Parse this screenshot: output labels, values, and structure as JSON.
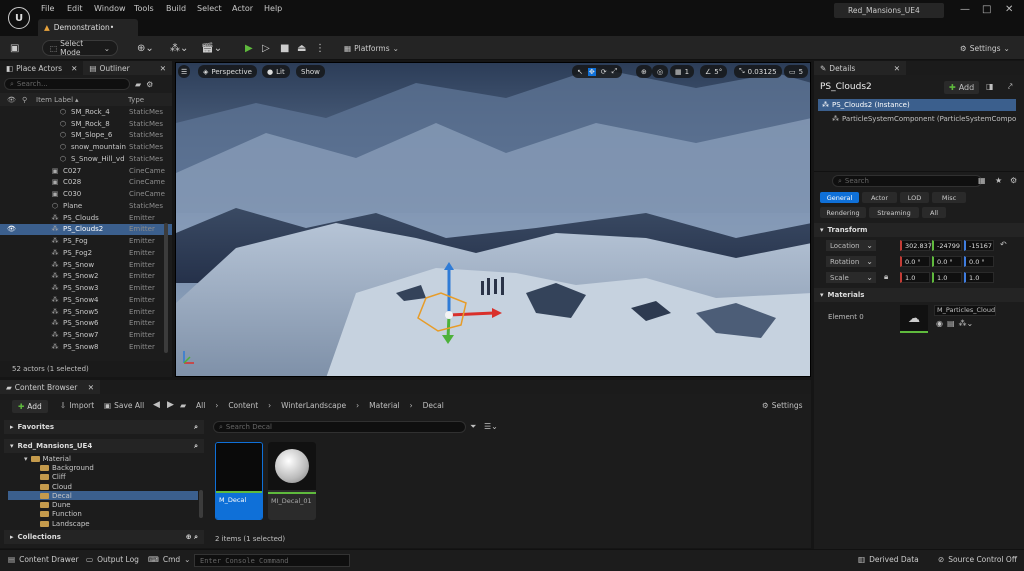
{
  "titlebar": {
    "menu": [
      "File",
      "Edit",
      "Window",
      "Tools",
      "Build",
      "Select",
      "Actor",
      "Help"
    ],
    "document_tab": "Demonstration•",
    "project_name": "Red_Mansions_UE4"
  },
  "toolbar": {
    "select_mode": "Select Mode",
    "platforms": "Platforms",
    "settings": "Settings"
  },
  "outliner": {
    "tabs": [
      "Place Actors",
      "Outliner"
    ],
    "search_placeholder": "Search...",
    "col_label": "Item Label",
    "col_type": "Type",
    "rows": [
      {
        "label": "SM_Rock_4",
        "type": "StaticMes",
        "icon": "mesh",
        "indent": 2
      },
      {
        "label": "SM_Rock_8",
        "type": "StaticMes",
        "icon": "mesh",
        "indent": 2
      },
      {
        "label": "SM_Slope_6",
        "type": "StaticMes",
        "icon": "mesh",
        "indent": 2
      },
      {
        "label": "snow_mountain",
        "type": "StaticMes",
        "icon": "mesh",
        "indent": 2
      },
      {
        "label": "S_Snow_Hill_vd",
        "type": "StaticMes",
        "icon": "mesh",
        "indent": 2
      },
      {
        "label": "C027",
        "type": "CineCame",
        "icon": "camera",
        "indent": 1
      },
      {
        "label": "C028",
        "type": "CineCame",
        "icon": "camera",
        "indent": 1
      },
      {
        "label": "C030",
        "type": "CineCame",
        "icon": "camera",
        "indent": 1
      },
      {
        "label": "Plane",
        "type": "StaticMes",
        "icon": "mesh",
        "indent": 1
      },
      {
        "label": "PS_Clouds",
        "type": "Emitter",
        "icon": "emitter",
        "indent": 1
      },
      {
        "label": "PS_Clouds2",
        "type": "Emitter",
        "icon": "emitter",
        "indent": 1,
        "selected": true
      },
      {
        "label": "PS_Fog",
        "type": "Emitter",
        "icon": "emitter",
        "indent": 1
      },
      {
        "label": "PS_Fog2",
        "type": "Emitter",
        "icon": "emitter",
        "indent": 1
      },
      {
        "label": "PS_Snow",
        "type": "Emitter",
        "icon": "emitter",
        "indent": 1
      },
      {
        "label": "PS_Snow2",
        "type": "Emitter",
        "icon": "emitter",
        "indent": 1
      },
      {
        "label": "PS_Snow3",
        "type": "Emitter",
        "icon": "emitter",
        "indent": 1
      },
      {
        "label": "PS_Snow4",
        "type": "Emitter",
        "icon": "emitter",
        "indent": 1
      },
      {
        "label": "PS_Snow5",
        "type": "Emitter",
        "icon": "emitter",
        "indent": 1
      },
      {
        "label": "PS_Snow6",
        "type": "Emitter",
        "icon": "emitter",
        "indent": 1
      },
      {
        "label": "PS_Snow7",
        "type": "Emitter",
        "icon": "emitter",
        "indent": 1
      },
      {
        "label": "PS_Snow8",
        "type": "Emitter",
        "icon": "emitter",
        "indent": 1
      }
    ],
    "footer": "52 actors (1 selected)"
  },
  "viewport": {
    "perspective": "Perspective",
    "lit": "Lit",
    "show": "Show",
    "grid": "1",
    "angle": "5°",
    "scale": "0.03125",
    "camera_speed": "5"
  },
  "details": {
    "tab": "Details",
    "actor_name": "PS_Clouds2",
    "add": "Add",
    "instance": "PS_Clouds2 (Instance)",
    "component": "ParticleSystemComponent (ParticleSystemCompo",
    "search_placeholder": "Search",
    "filters_row1": [
      "General",
      "Actor",
      "LOD",
      "Misc"
    ],
    "filters_row2": [
      "Rendering",
      "Streaming",
      "All"
    ],
    "transform_title": "Transform",
    "location_label": "Location",
    "location": [
      "302.837",
      "-24799",
      "-15167"
    ],
    "rotation_label": "Rotation",
    "rotation": [
      "0.0 °",
      "0.0 °",
      "0.0 °"
    ],
    "scale_label": "Scale",
    "scale": [
      "1.0",
      "1.0",
      "1.0"
    ],
    "materials_title": "Materials",
    "element_label": "Element 0",
    "material_name": "M_Particles_Cloud"
  },
  "content_browser": {
    "tab": "Content Browser",
    "add": "Add",
    "import": "Import",
    "save_all": "Save All",
    "breadcrumb": [
      "All",
      "Content",
      "WinterLandscape",
      "Material",
      "Decal"
    ],
    "settings": "Settings",
    "favorites": "Favorites",
    "project": "Red_Mansions_UE4",
    "tree_root": "Material",
    "folders": [
      "Background",
      "Cliff",
      "Cloud",
      "Decal",
      "Dune",
      "Function",
      "Landscape"
    ],
    "selected_folder": "Decal",
    "collections": "Collections",
    "search_placeholder": "Search Decal",
    "assets": [
      {
        "name": "M_Decal",
        "selected": true
      },
      {
        "name": "MI_Decal_01",
        "selected": false
      }
    ],
    "footer": "2 items (1 selected)"
  },
  "statusbar": {
    "content_drawer": "Content Drawer",
    "output_log": "Output Log",
    "cmd": "Cmd",
    "console_placeholder": "Enter Console Command",
    "derived_data": "Derived Data",
    "source_control": "Source Control Off"
  }
}
